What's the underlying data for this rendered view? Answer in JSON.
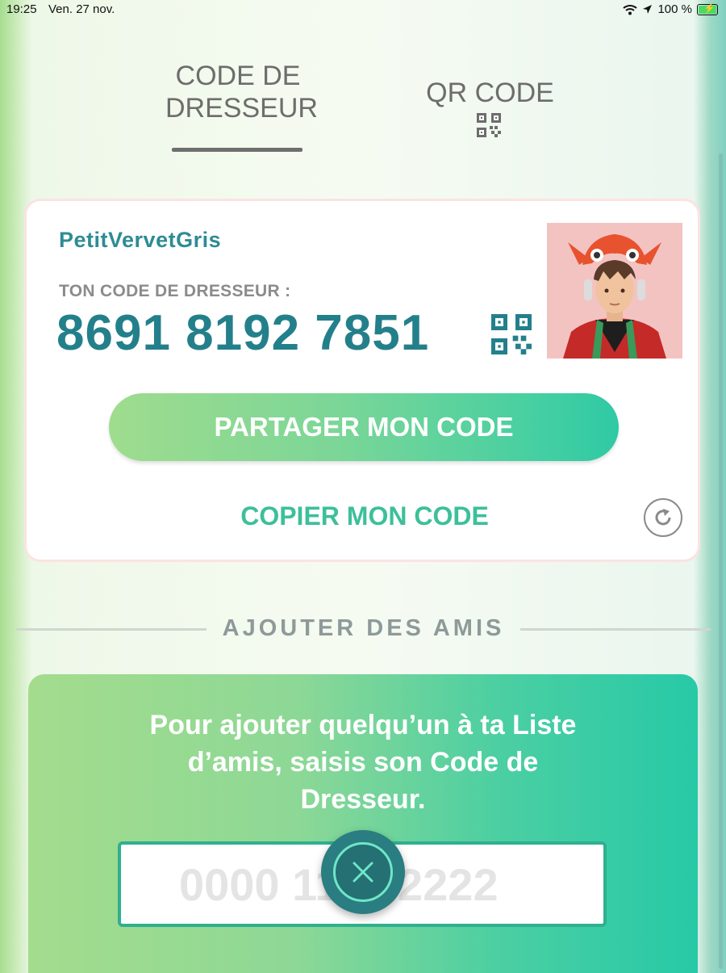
{
  "status": {
    "time": "19:25",
    "date": "Ven. 27 nov.",
    "battery": "100 %"
  },
  "tabs": {
    "trainer_line1": "CODE DE",
    "trainer_line2": "DRESSEUR",
    "qr": "QR CODE"
  },
  "card": {
    "username": "PetitVervetGris",
    "code_label": "TON CODE DE DRESSEUR :",
    "code_value": "8691 8192 7851",
    "share_label": "PARTAGER MON CODE",
    "copy_label": "COPIER MON CODE"
  },
  "add_friends": {
    "title": "AJOUTER DES AMIS",
    "instructions": "Pour ajouter quelqu’un à ta Liste d’amis, saisis son Code de Dresseur.",
    "placeholder": "0000 1111 2222"
  },
  "icons": {
    "wifi": "wifi-icon",
    "location": "location-arrow-icon",
    "battery": "battery-charging-icon",
    "qr": "qr-code-icon",
    "refresh": "refresh-icon",
    "close": "close-icon"
  },
  "colors": {
    "accent_teal": "#23808b",
    "accent_green": "#3dbf9a",
    "fab": "#2a7d80"
  }
}
